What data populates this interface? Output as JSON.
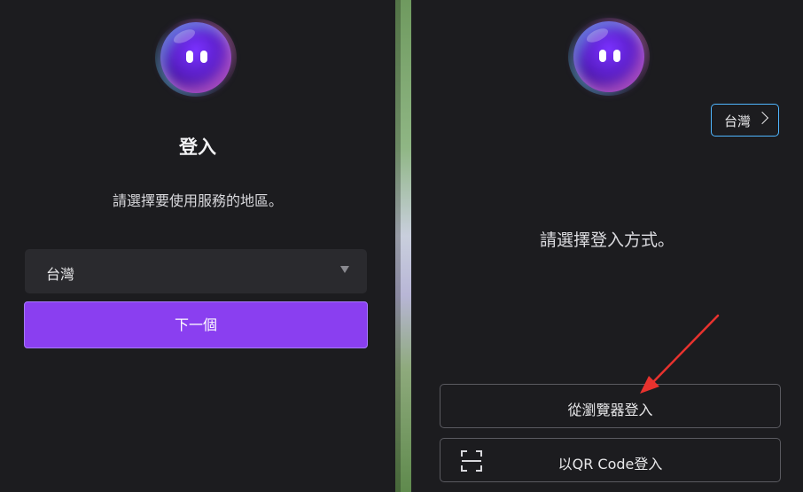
{
  "left_panel": {
    "logo": "bubble-mascot-logo",
    "title": "登入",
    "region_prompt": "請選擇要使用服務的地區。",
    "region_select": {
      "selected": "台灣"
    },
    "next_button_label": "下一個"
  },
  "right_panel": {
    "logo": "bubble-mascot-logo",
    "region_badge": {
      "label": "台灣",
      "icon": "chevron-right-icon"
    },
    "method_prompt": "請選擇登入方式。",
    "browser_login_label": "從瀏覽器登入",
    "qr_login_label": "以QR Code登入",
    "qr_icon": "qr-scan-icon"
  },
  "annotation": {
    "type": "arrow",
    "color": "#e8322e",
    "points_to": "browser-login-button"
  },
  "colors": {
    "accent": "#8a3ff0",
    "badge_border": "#4fb6ff",
    "background": "#1c1c1f"
  }
}
